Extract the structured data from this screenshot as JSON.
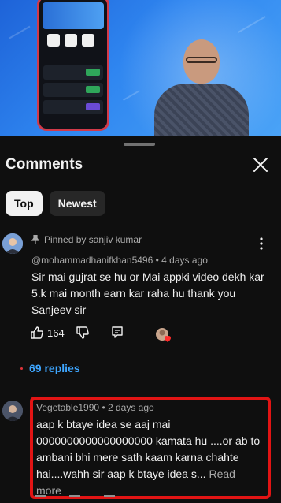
{
  "video": {
    "brand_color": "#2f86f0"
  },
  "sheet": {
    "title": "Comments"
  },
  "chips": [
    {
      "label": "Top",
      "selected": true
    },
    {
      "label": "Newest",
      "selected": false
    }
  ],
  "comment1": {
    "pinned_label": "Pinned by sanjiv kumar",
    "author": "@mohammadhanifkhan5496",
    "time": "4 days ago",
    "text": "Sir mai gujrat se hu or Mai appki video dekh kar 5.k mai month earn kar raha hu thank you Sanjeev sir",
    "likes": "164",
    "replies_label": "69 replies"
  },
  "comment2": {
    "author": "Vegetable1990",
    "time": "2 days ago",
    "text": "aap k btaye idea se aaj mai 0000000000000000000 kamata hu ....or ab to ambani bhi mere sath kaam karna chahte hai....wahh sir aap k btaye idea s...",
    "read_more": "Read more"
  },
  "icons": {
    "close": "close-icon",
    "pin": "pin-icon",
    "more": "more-vert-icon",
    "like": "thumb-up-icon",
    "dislike": "thumb-down-icon",
    "reply": "reply-icon"
  },
  "colors": {
    "background": "#0f0f0f",
    "link": "#3ea6ff",
    "highlight_box": "#e21414"
  }
}
